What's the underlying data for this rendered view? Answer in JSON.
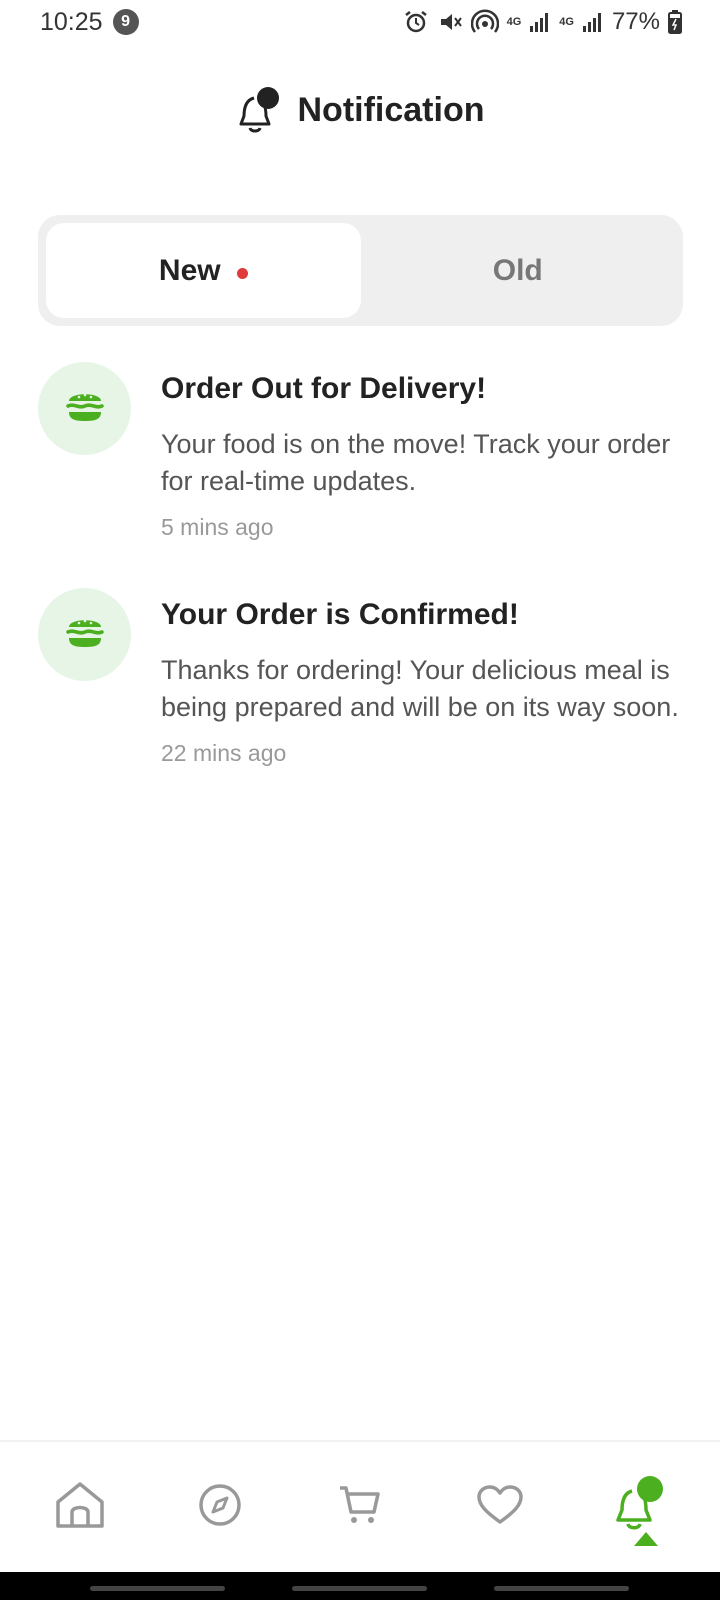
{
  "status_bar": {
    "time": "10:25",
    "notification_count": "9",
    "net1": "4G",
    "net2": "4G",
    "battery": "77%"
  },
  "header": {
    "title": "Notification"
  },
  "tabs": [
    {
      "label": "New",
      "active": true,
      "has_dot": true
    },
    {
      "label": "Old",
      "active": false
    }
  ],
  "notifications": [
    {
      "title": "Order Out for Delivery!",
      "text": "Your food is on the move! Track your order for real-time updates.",
      "time": "5 mins ago",
      "icon": "burger-icon"
    },
    {
      "title": "Your Order is Confirmed!",
      "text": "Thanks for ordering! Your delicious meal is being prepared and will be on its way soon.",
      "time": "22 mins ago",
      "icon": "burger-icon"
    }
  ],
  "bottom_nav": [
    {
      "name": "home",
      "icon": "home-icon",
      "active": false
    },
    {
      "name": "explore",
      "icon": "compass-icon",
      "active": false
    },
    {
      "name": "cart",
      "icon": "cart-icon",
      "active": false
    },
    {
      "name": "favorites",
      "icon": "heart-icon",
      "active": false
    },
    {
      "name": "notifications",
      "icon": "bell-icon",
      "active": true
    }
  ],
  "colors": {
    "accent": "#4caf1f",
    "avatar_bg": "#e6f5e6",
    "new_dot": "#e03a3a"
  }
}
